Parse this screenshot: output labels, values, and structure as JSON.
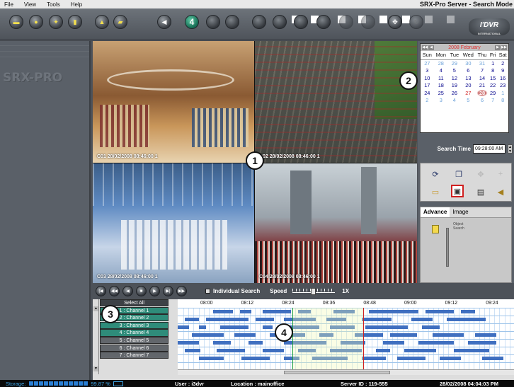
{
  "menu": [
    "File",
    "View",
    "Tools",
    "Help"
  ],
  "window_title": "SRX-Pro Server - Search Mode",
  "toolbar": {
    "split_label": "4",
    "logo_text": "I'DVR",
    "logo_sub": "INTERNATIONAL"
  },
  "left_brand": "SRX-PRO",
  "cameras": [
    {
      "ts": "C01 28/02/2008 08:46:00 1"
    },
    {
      "ts": "C02 28/02/2008 08:46:00 1"
    },
    {
      "ts": "C03 28/02/2008 08:46:00 1"
    },
    {
      "ts": "C04 28/02/2008 08:46:00 1"
    }
  ],
  "markers": [
    "1",
    "2",
    "3",
    "4"
  ],
  "calendar": {
    "month": "2008 February",
    "weekdays": [
      "Sun",
      "Mon",
      "Tue",
      "Wed",
      "Thu",
      "Fri",
      "Sat"
    ],
    "weeks": [
      [
        "27",
        "28",
        "29",
        "30",
        "31",
        "1",
        "2"
      ],
      [
        "3",
        "4",
        "5",
        "6",
        "7",
        "8",
        "9"
      ],
      [
        "10",
        "11",
        "12",
        "13",
        "14",
        "15",
        "16"
      ],
      [
        "17",
        "18",
        "19",
        "20",
        "21",
        "22",
        "23"
      ],
      [
        "24",
        "25",
        "26",
        "27",
        "28",
        "29",
        "1"
      ],
      [
        "2",
        "3",
        "4",
        "5",
        "6",
        "7",
        "8"
      ]
    ],
    "selected": "28"
  },
  "search_time": {
    "label": "Search Time",
    "value": "09:28:00 AM"
  },
  "tabs": {
    "advance": "Advance",
    "image": "Image",
    "object_search": "Object Search"
  },
  "playback": {
    "individual_search": "Individual Search",
    "speed": "Speed",
    "speed_value": "1X"
  },
  "timeline": {
    "times": [
      "08:00",
      "08:12",
      "08:24",
      "08:36",
      "08:48",
      "09:00",
      "09:12",
      "09:24"
    ],
    "select_all": "Select All",
    "channels": [
      {
        "name": "1 : Channel 1",
        "active": true
      },
      {
        "name": "2 : Channel 2",
        "active": true
      },
      {
        "name": "3 : Channel 3",
        "active": true
      },
      {
        "name": "4 : Channel 4",
        "active": true
      },
      {
        "name": "5 : Channel 5",
        "active": false
      },
      {
        "name": "6 : Channel 6",
        "active": false
      },
      {
        "name": "7 : Channel 7",
        "active": false
      }
    ]
  },
  "status": {
    "storage_label": "Storage:",
    "storage_pct": "99.87 %",
    "user": "User : i3dvr",
    "location": "Location : mainoffice",
    "server_id": "Server ID : 119-555",
    "datetime": "28/02/2008 04:04:03 PM"
  }
}
